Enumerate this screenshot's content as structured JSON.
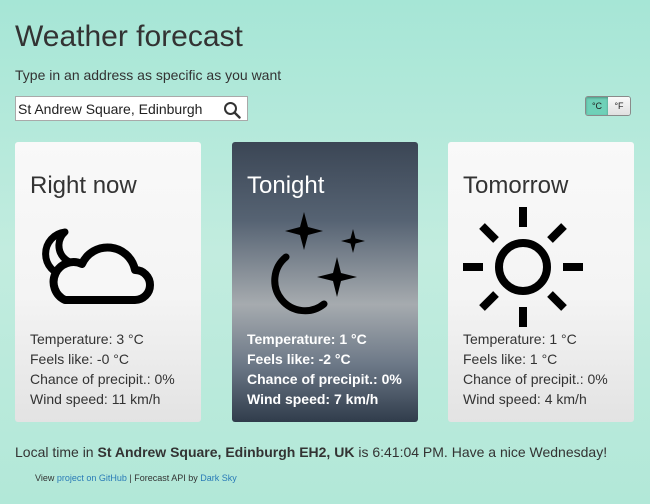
{
  "header": {
    "title": "Weather forecast",
    "subtitle": "Type in an address as specific as you want"
  },
  "search": {
    "value": "St Andrew Square, Edinburgh",
    "icon": "search-icon"
  },
  "units": {
    "celsius": "°C",
    "fahrenheit": "°F",
    "selected": "°C"
  },
  "cards": [
    {
      "heading": "Right now",
      "icon": "night-partly-cloudy-icon",
      "temperature": "Temperature: 3 °C",
      "feels_like": "Feels like: -0 °C",
      "precip": "Chance of precipit.: 0%",
      "wind": "Wind speed: 11 km/h"
    },
    {
      "heading": "Tonight",
      "icon": "clear-night-icon",
      "temperature": "Temperature: 1 °C",
      "feels_like": "Feels like: -2 °C",
      "precip": "Chance of precipit.: 0%",
      "wind": "Wind speed: 7 km/h"
    },
    {
      "heading": "Tomorrow",
      "icon": "sun-icon",
      "temperature": "Temperature: 1 °C",
      "feels_like": "Feels like: 1 °C",
      "precip": "Chance of precipit.: 0%",
      "wind": "Wind speed: 4 km/h"
    }
  ],
  "local": {
    "prefix": "Local time in ",
    "location": "St Andrew Square, Edinburgh EH2, UK",
    "middle": " is 6:41:04 PM. Have a nice Wednesday!"
  },
  "footer": {
    "view": "View ",
    "github_link": "project on GitHub",
    "sep": " | Forecast API by ",
    "darksky_link": "Dark Sky"
  },
  "colors": {
    "toggle_active": "#6fd1b8",
    "link": "#2a7bb7",
    "background": "#b2e8d8"
  }
}
